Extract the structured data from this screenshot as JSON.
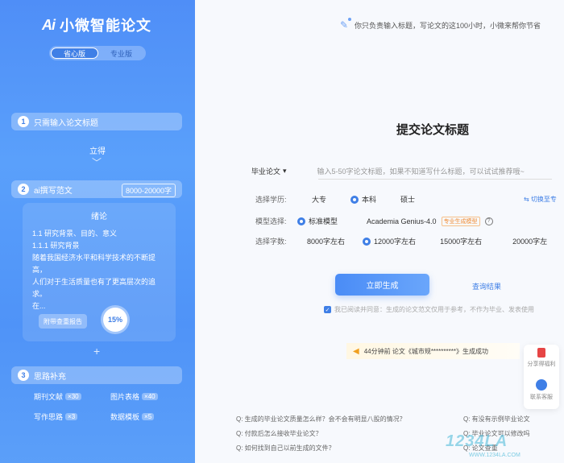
{
  "sidebar": {
    "logo_mark": "Ai",
    "logo_text": "小微智能论文",
    "versions": [
      "省心版",
      "专业版"
    ],
    "steps": [
      {
        "num": "1",
        "label": "只需输入论文标题"
      },
      {
        "num": "2",
        "label": "ai撰写范文",
        "badge": "8000-20000字"
      },
      {
        "num": "3",
        "label": "思路补充"
      }
    ],
    "stand_text": "立得",
    "paper": {
      "title": "绪论",
      "lines": [
        "1.1 研究背景、目的、意义",
        "1.1.1 研究背景",
        "随着我国经济水平和科学技术的不断提高，",
        "人们对于生活质量也有了更高层次的追求。",
        "在..."
      ],
      "report_btn": "附带查重报告",
      "progress": "15%"
    },
    "features": [
      {
        "label": "期刊文献",
        "tag": "×30"
      },
      {
        "label": "图片表格",
        "tag": "×40"
      },
      {
        "label": "写作思路",
        "tag": "×3"
      },
      {
        "label": "数据模板",
        "tag": "×5"
      }
    ]
  },
  "main": {
    "banner": "你只负责输入标题，写论文的这100小时，小微来帮你节省",
    "form_title": "提交论文标题",
    "paper_type": "毕业论文",
    "title_placeholder": "输入5-50字论文标题，如果不知道写什么标题，可以试试推荐哦~",
    "edu_label": "选择学历:",
    "edu_options": [
      "大专",
      "本科",
      "硕士"
    ],
    "switch_link": "切换至专",
    "model_label": "模型选择:",
    "model_options": [
      "标准模型",
      "Academia Genius-4.0"
    ],
    "pro_tag": "专业生成模型",
    "words_label": "选择字数:",
    "words_options": [
      "8000字左右",
      "12000字左右",
      "15000字左右",
      "20000字左"
    ],
    "generate_btn": "立即生成",
    "query_link": "查询结果",
    "agree_text": "我已阅读并同意：生成的论文范文仅用于参考，不作为毕业、发表使用",
    "notice": "44分钟前 论文《城市规**********》生成成功",
    "float_items": [
      "分享得福利",
      "联系客服"
    ],
    "faq": [
      "Q: 生成的毕业论文质量怎么样？会不会有明显八股的情况？",
      "Q: 有没有示例毕业论文",
      "Q: 付款后怎么接收毕业论文？",
      "Q: 毕业论文可以修改吗",
      "Q: 如何找到自己以前生成的文件？",
      "Q: 论文查重"
    ],
    "watermark": "1234LA",
    "watermark_sub": "WWW.1234LA.COM"
  }
}
